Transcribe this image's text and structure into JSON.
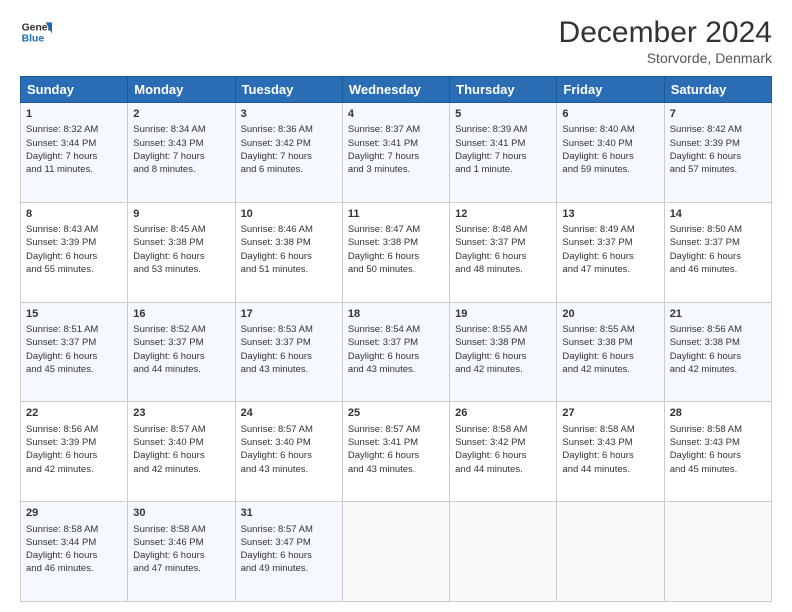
{
  "header": {
    "logo_line1": "General",
    "logo_line2": "Blue",
    "month_title": "December 2024",
    "location": "Storvorde, Denmark"
  },
  "weekdays": [
    "Sunday",
    "Monday",
    "Tuesday",
    "Wednesday",
    "Thursday",
    "Friday",
    "Saturday"
  ],
  "weeks": [
    [
      {
        "day": "1",
        "lines": [
          "Sunrise: 8:32 AM",
          "Sunset: 3:44 PM",
          "Daylight: 7 hours",
          "and 11 minutes."
        ]
      },
      {
        "day": "2",
        "lines": [
          "Sunrise: 8:34 AM",
          "Sunset: 3:43 PM",
          "Daylight: 7 hours",
          "and 8 minutes."
        ]
      },
      {
        "day": "3",
        "lines": [
          "Sunrise: 8:36 AM",
          "Sunset: 3:42 PM",
          "Daylight: 7 hours",
          "and 6 minutes."
        ]
      },
      {
        "day": "4",
        "lines": [
          "Sunrise: 8:37 AM",
          "Sunset: 3:41 PM",
          "Daylight: 7 hours",
          "and 3 minutes."
        ]
      },
      {
        "day": "5",
        "lines": [
          "Sunrise: 8:39 AM",
          "Sunset: 3:41 PM",
          "Daylight: 7 hours",
          "and 1 minute."
        ]
      },
      {
        "day": "6",
        "lines": [
          "Sunrise: 8:40 AM",
          "Sunset: 3:40 PM",
          "Daylight: 6 hours",
          "and 59 minutes."
        ]
      },
      {
        "day": "7",
        "lines": [
          "Sunrise: 8:42 AM",
          "Sunset: 3:39 PM",
          "Daylight: 6 hours",
          "and 57 minutes."
        ]
      }
    ],
    [
      {
        "day": "8",
        "lines": [
          "Sunrise: 8:43 AM",
          "Sunset: 3:39 PM",
          "Daylight: 6 hours",
          "and 55 minutes."
        ]
      },
      {
        "day": "9",
        "lines": [
          "Sunrise: 8:45 AM",
          "Sunset: 3:38 PM",
          "Daylight: 6 hours",
          "and 53 minutes."
        ]
      },
      {
        "day": "10",
        "lines": [
          "Sunrise: 8:46 AM",
          "Sunset: 3:38 PM",
          "Daylight: 6 hours",
          "and 51 minutes."
        ]
      },
      {
        "day": "11",
        "lines": [
          "Sunrise: 8:47 AM",
          "Sunset: 3:38 PM",
          "Daylight: 6 hours",
          "and 50 minutes."
        ]
      },
      {
        "day": "12",
        "lines": [
          "Sunrise: 8:48 AM",
          "Sunset: 3:37 PM",
          "Daylight: 6 hours",
          "and 48 minutes."
        ]
      },
      {
        "day": "13",
        "lines": [
          "Sunrise: 8:49 AM",
          "Sunset: 3:37 PM",
          "Daylight: 6 hours",
          "and 47 minutes."
        ]
      },
      {
        "day": "14",
        "lines": [
          "Sunrise: 8:50 AM",
          "Sunset: 3:37 PM",
          "Daylight: 6 hours",
          "and 46 minutes."
        ]
      }
    ],
    [
      {
        "day": "15",
        "lines": [
          "Sunrise: 8:51 AM",
          "Sunset: 3:37 PM",
          "Daylight: 6 hours",
          "and 45 minutes."
        ]
      },
      {
        "day": "16",
        "lines": [
          "Sunrise: 8:52 AM",
          "Sunset: 3:37 PM",
          "Daylight: 6 hours",
          "and 44 minutes."
        ]
      },
      {
        "day": "17",
        "lines": [
          "Sunrise: 8:53 AM",
          "Sunset: 3:37 PM",
          "Daylight: 6 hours",
          "and 43 minutes."
        ]
      },
      {
        "day": "18",
        "lines": [
          "Sunrise: 8:54 AM",
          "Sunset: 3:37 PM",
          "Daylight: 6 hours",
          "and 43 minutes."
        ]
      },
      {
        "day": "19",
        "lines": [
          "Sunrise: 8:55 AM",
          "Sunset: 3:38 PM",
          "Daylight: 6 hours",
          "and 42 minutes."
        ]
      },
      {
        "day": "20",
        "lines": [
          "Sunrise: 8:55 AM",
          "Sunset: 3:38 PM",
          "Daylight: 6 hours",
          "and 42 minutes."
        ]
      },
      {
        "day": "21",
        "lines": [
          "Sunrise: 8:56 AM",
          "Sunset: 3:38 PM",
          "Daylight: 6 hours",
          "and 42 minutes."
        ]
      }
    ],
    [
      {
        "day": "22",
        "lines": [
          "Sunrise: 8:56 AM",
          "Sunset: 3:39 PM",
          "Daylight: 6 hours",
          "and 42 minutes."
        ]
      },
      {
        "day": "23",
        "lines": [
          "Sunrise: 8:57 AM",
          "Sunset: 3:40 PM",
          "Daylight: 6 hours",
          "and 42 minutes."
        ]
      },
      {
        "day": "24",
        "lines": [
          "Sunrise: 8:57 AM",
          "Sunset: 3:40 PM",
          "Daylight: 6 hours",
          "and 43 minutes."
        ]
      },
      {
        "day": "25",
        "lines": [
          "Sunrise: 8:57 AM",
          "Sunset: 3:41 PM",
          "Daylight: 6 hours",
          "and 43 minutes."
        ]
      },
      {
        "day": "26",
        "lines": [
          "Sunrise: 8:58 AM",
          "Sunset: 3:42 PM",
          "Daylight: 6 hours",
          "and 44 minutes."
        ]
      },
      {
        "day": "27",
        "lines": [
          "Sunrise: 8:58 AM",
          "Sunset: 3:43 PM",
          "Daylight: 6 hours",
          "and 44 minutes."
        ]
      },
      {
        "day": "28",
        "lines": [
          "Sunrise: 8:58 AM",
          "Sunset: 3:43 PM",
          "Daylight: 6 hours",
          "and 45 minutes."
        ]
      }
    ],
    [
      {
        "day": "29",
        "lines": [
          "Sunrise: 8:58 AM",
          "Sunset: 3:44 PM",
          "Daylight: 6 hours",
          "and 46 minutes."
        ]
      },
      {
        "day": "30",
        "lines": [
          "Sunrise: 8:58 AM",
          "Sunset: 3:46 PM",
          "Daylight: 6 hours",
          "and 47 minutes."
        ]
      },
      {
        "day": "31",
        "lines": [
          "Sunrise: 8:57 AM",
          "Sunset: 3:47 PM",
          "Daylight: 6 hours",
          "and 49 minutes."
        ]
      },
      null,
      null,
      null,
      null
    ]
  ]
}
